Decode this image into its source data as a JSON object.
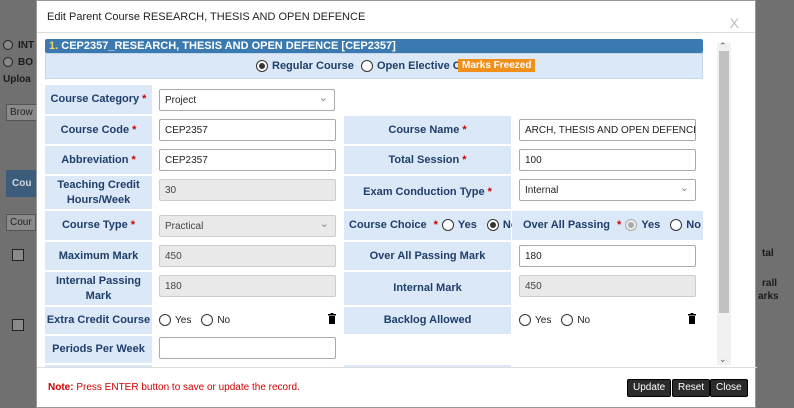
{
  "background": {
    "radio1_label": "INT",
    "radio2_label": "BO",
    "upload_label": "Uploa",
    "browse_label": "Brow",
    "tab_label": "Cou",
    "tab2_label": "Cour",
    "right_col1": "tal",
    "right_col2a": "rall",
    "right_col2b": "arks"
  },
  "modal": {
    "title": "Edit Parent Course RESEARCH, THESIS AND OPEN DEFENCE",
    "close": "X"
  },
  "section": {
    "number": "1.",
    "title": "CEP2357_RESEARCH, THESIS AND OPEN DEFENCE [CEP2357]"
  },
  "course_type_bar": {
    "regular": "Regular Course",
    "open_elective": "Open Elective Course",
    "freeze_badge": "Marks Freezed"
  },
  "form": {
    "course_category": {
      "label": "Course Category",
      "value": "Project"
    },
    "course_code": {
      "label": "Course Code",
      "value": "CEP2357"
    },
    "course_name": {
      "label": "Course Name",
      "value": "ARCH, THESIS AND OPEN DEFENCE"
    },
    "abbreviation": {
      "label": "Abbreviation",
      "value": "CEP2357"
    },
    "total_session": {
      "label": "Total Session",
      "value": "100"
    },
    "teaching_credit": {
      "label_1": "Teaching Credit",
      "label_2": "Hours/Week",
      "value": "30"
    },
    "exam_conduction_type": {
      "label": "Exam Conduction Type",
      "value": "Internal"
    },
    "course_type": {
      "label": "Course Type",
      "value": "Practical"
    },
    "course_choice": {
      "label": "Course Choice",
      "yes": "Yes",
      "no": "No"
    },
    "over_all_passing": {
      "label": "Over All Passing",
      "yes": "Yes",
      "no": "No"
    },
    "maximum_mark": {
      "label": "Maximum Mark",
      "value": "450"
    },
    "over_all_passing_mark": {
      "label": "Over All Passing Mark",
      "value": "180"
    },
    "internal_passing_mark": {
      "label_1": "Internal Passing",
      "label_2": "Mark",
      "value": "180"
    },
    "internal_mark": {
      "label": "Internal Mark",
      "value": "450"
    },
    "extra_credit_course": {
      "label": "Extra Credit Course",
      "yes": "Yes",
      "no": "No"
    },
    "backlog_allowed": {
      "label": "Backlog Allowed",
      "yes": "Yes",
      "no": "No"
    },
    "periods_per_week": {
      "label": "Periods Per Week",
      "value": ""
    },
    "required_marker": "*"
  },
  "footer": {
    "note_label": "Note:",
    "note_text": "Press ENTER button to save or update the record.",
    "update": "Update",
    "reset": "Reset",
    "close": "Close"
  },
  "colors": {
    "section_bar": "#3b7ab0",
    "label_bg": "#dbe8f7",
    "label_text": "#1f3e69",
    "badge": "#f0901b",
    "note": "#d10000"
  }
}
